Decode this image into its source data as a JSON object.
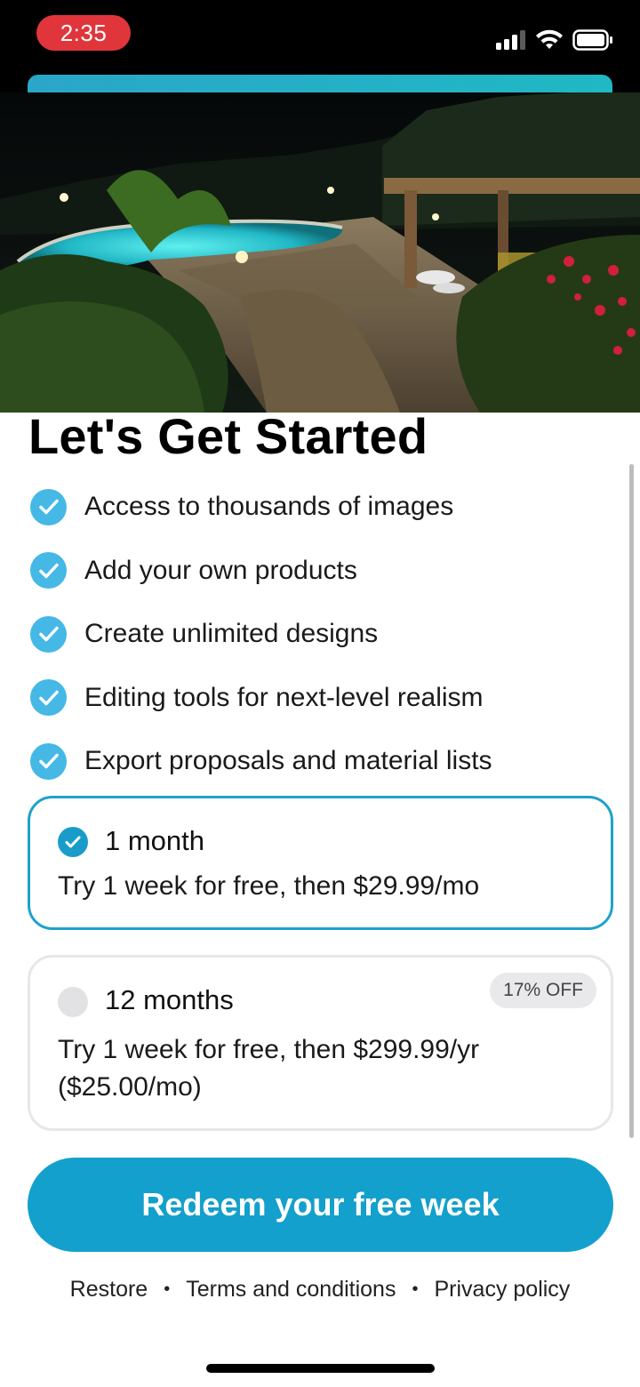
{
  "status_bar": {
    "time": "2:35",
    "icons": [
      "signal-icon",
      "wifi-icon",
      "battery-icon"
    ],
    "time_pill_color": "#e0363b"
  },
  "hero": {
    "image": "night-backyard-pool-patio-photo"
  },
  "main": {
    "title": "Let's Get Started",
    "features": [
      "Access to thousands of images",
      "Add your own products",
      "Create unlimited designs",
      "Editing tools for next-level realism",
      "Export proposals and material lists"
    ]
  },
  "plans": [
    {
      "title": "1 month",
      "description": "Try 1 week for free, then $29.99/mo",
      "selected": true
    },
    {
      "title": "12 months",
      "description_line1": "Try 1 week for free, then $299.99/yr",
      "description_line2": "($25.00/mo)",
      "badge": "17% OFF",
      "selected": false
    }
  ],
  "cta": {
    "label": "Redeem your free week"
  },
  "footer": {
    "restore": "Restore",
    "terms": "Terms and conditions",
    "privacy": "Privacy policy"
  },
  "colors": {
    "accent": "#14a0cc",
    "check": "#45b8e6",
    "selected_border": "#1ea2cc"
  }
}
